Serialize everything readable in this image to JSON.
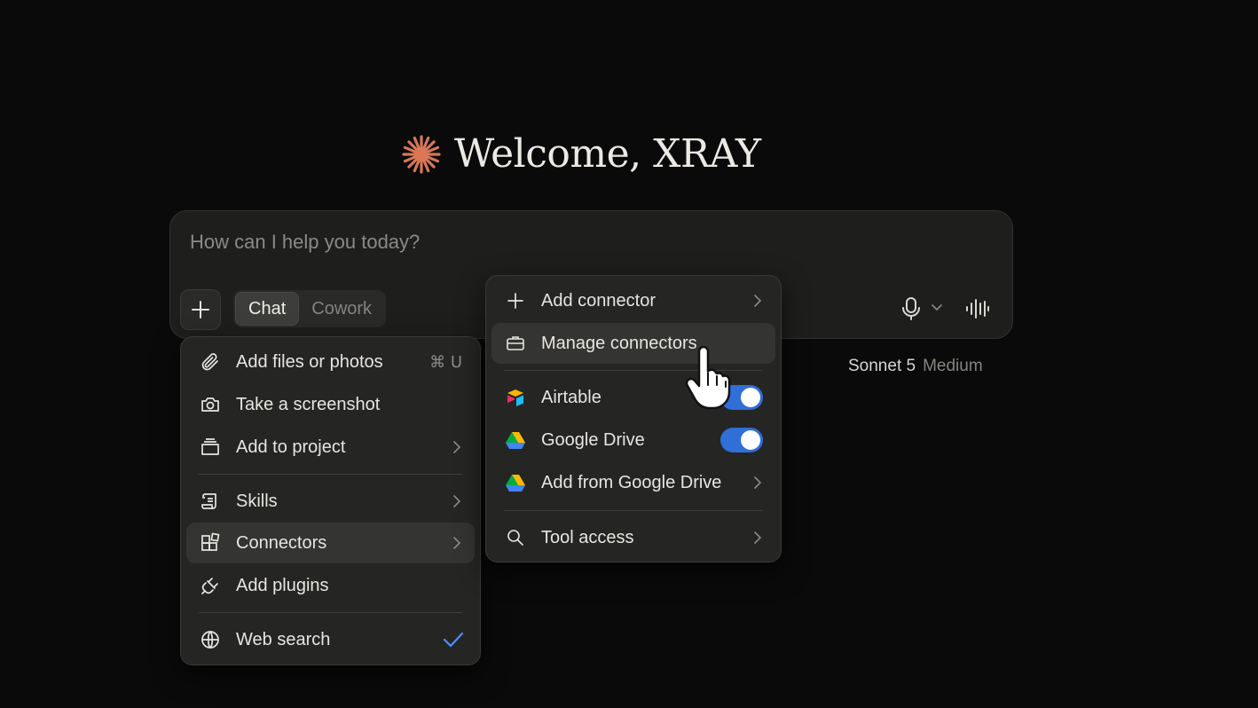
{
  "welcome": {
    "text": "Welcome, XRAY",
    "logo_color": "#d97757"
  },
  "composer": {
    "placeholder": "How can I help you today?",
    "modes": [
      {
        "label": "Chat",
        "active": true
      },
      {
        "label": "Cowork",
        "active": false
      }
    ]
  },
  "model": {
    "name": "Sonnet 5",
    "level": "Medium"
  },
  "attach_menu": {
    "items": [
      {
        "label": "Add files or photos",
        "icon": "paperclip-icon",
        "shortcut": "⌘ U"
      },
      {
        "label": "Take a screenshot",
        "icon": "camera-icon"
      },
      {
        "label": "Add to project",
        "icon": "project-icon",
        "has_submenu": true
      },
      {
        "label": "Skills",
        "icon": "scroll-icon",
        "has_submenu": true
      },
      {
        "label": "Connectors",
        "icon": "connectors-icon",
        "has_submenu": true,
        "highlighted": true
      },
      {
        "label": "Add plugins",
        "icon": "plug-icon"
      },
      {
        "label": "Web search",
        "icon": "globe-icon",
        "checked": true
      }
    ]
  },
  "connectors_menu": {
    "items": [
      {
        "label": "Add connector",
        "icon": "plus-icon",
        "has_submenu": true
      },
      {
        "label": "Manage connectors",
        "icon": "briefcase-icon",
        "highlighted": true
      },
      {
        "label": "Airtable",
        "icon": "airtable-icon",
        "enabled": true
      },
      {
        "label": "Google Drive",
        "icon": "google-drive-icon",
        "enabled": true
      },
      {
        "label": "Add from Google Drive",
        "icon": "google-drive-icon",
        "has_submenu": true
      },
      {
        "label": "Tool access",
        "icon": "search-icon",
        "has_submenu": true
      }
    ]
  },
  "colors": {
    "accent": "#2f6fd6",
    "brand": "#d97757",
    "check": "#4f8ff7"
  }
}
